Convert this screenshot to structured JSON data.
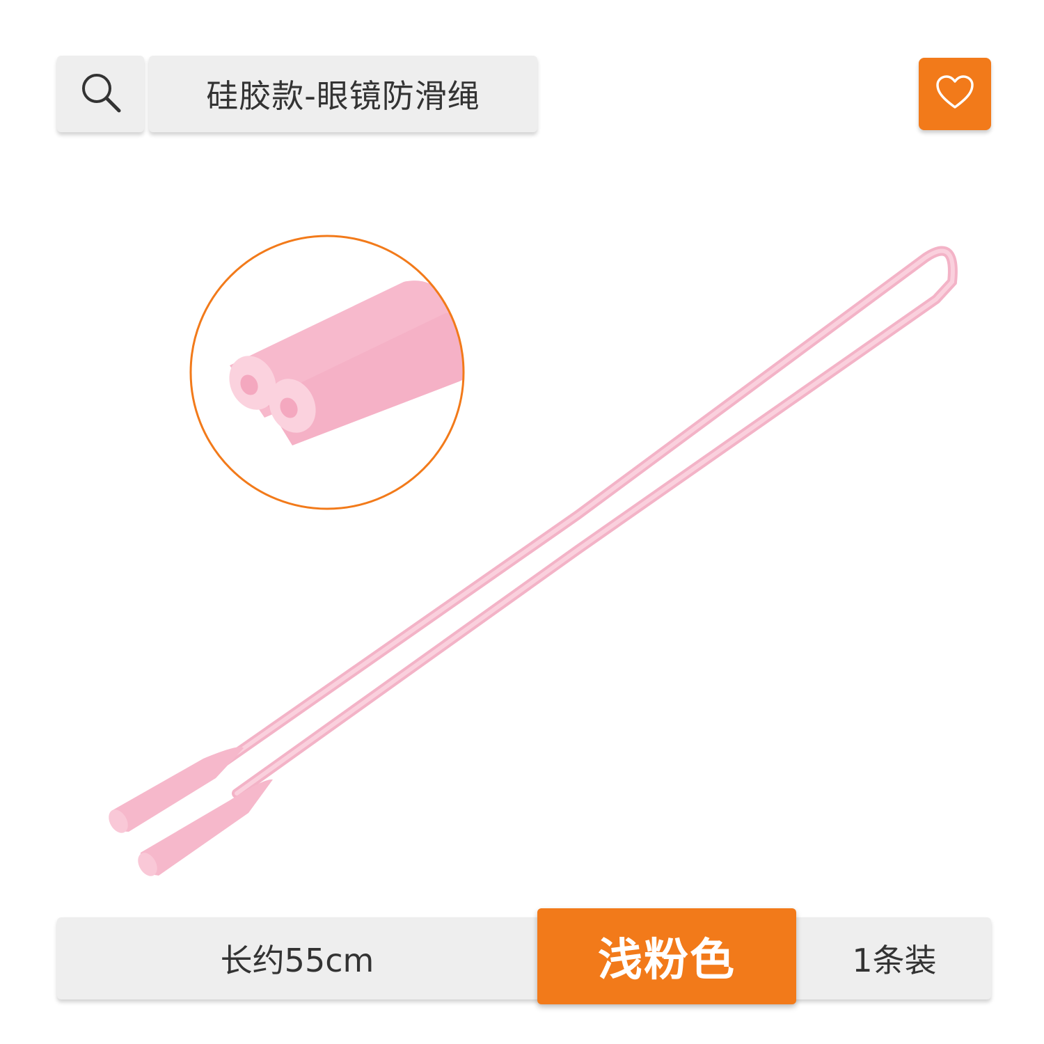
{
  "header": {
    "search_icon": "search-icon",
    "title": "硅胶款-眼镜防滑绳",
    "favorite_icon": "heart-icon"
  },
  "product_image": {
    "detail_callout": "zoom-detail-circle"
  },
  "options_bar": {
    "length_label": "长约55cm",
    "color_label": "浅粉色",
    "quantity_label": "1条装"
  },
  "colors": {
    "accent": "#f27a1a",
    "panel": "#eeeeee",
    "cord": "#f8c3d4"
  }
}
